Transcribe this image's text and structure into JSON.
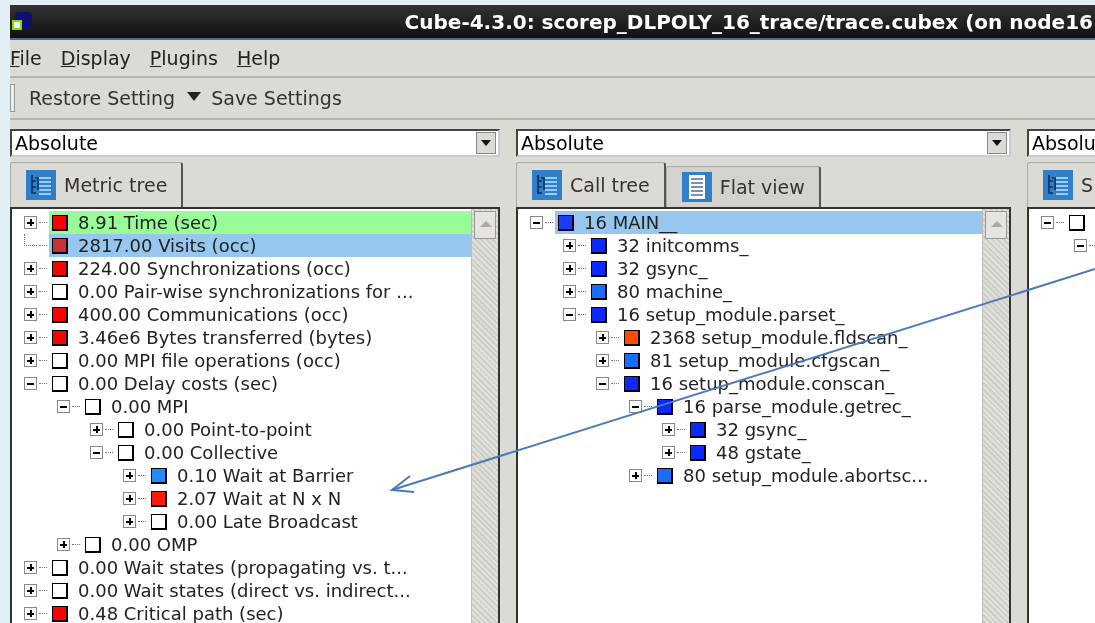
{
  "window": {
    "title": "Cube-4.3.0: scorep_DLPOLY_16_trace/trace.cubex (on node16"
  },
  "menu": [
    "File",
    "Display",
    "Plugins",
    "Help"
  ],
  "toolbar": {
    "restore": "Restore Setting",
    "save": "Save Settings"
  },
  "panes": [
    {
      "mode": "Absolute",
      "cut_off": false,
      "tabs": [
        {
          "label": "Metric tree",
          "kind": "tree",
          "selected": true
        }
      ],
      "tree": [
        {
          "label": "8.91 Time (sec)",
          "color": "#ff0000",
          "expanded": false,
          "selected": false,
          "marked": true
        },
        {
          "label": "2817.00 Visits (occ)",
          "color": "#c8303c",
          "expanded": false,
          "leaf": true,
          "selected": true,
          "marked": false
        },
        {
          "label": "224.00 Synchronizations (occ)",
          "color": "#ff0000",
          "expanded": false,
          "selected": false,
          "marked": false
        },
        {
          "label": "0.00 Pair-wise synchronizations for ...",
          "color": "#ffffff",
          "expanded": false,
          "selected": false,
          "marked": false
        },
        {
          "label": "400.00 Communications (occ)",
          "color": "#ff0000",
          "expanded": false,
          "selected": false,
          "marked": false
        },
        {
          "label": "3.46e6 Bytes transferred (bytes)",
          "color": "#ff0000",
          "expanded": false,
          "selected": false,
          "marked": false
        },
        {
          "label": "0.00 MPI file operations (occ)",
          "color": "#ffffff",
          "expanded": false,
          "selected": false,
          "marked": false
        },
        {
          "label": "0.00 Delay costs (sec)",
          "color": "#ffffff",
          "expanded": true,
          "selected": false,
          "marked": false,
          "children": [
            {
              "label": "0.00 MPI",
              "color": "#ffffff",
              "expanded": true,
              "selected": false,
              "marked": false,
              "children": [
                {
                  "label": "0.00 Point-to-point",
                  "color": "#ffffff",
                  "expanded": false,
                  "selected": false,
                  "marked": false
                },
                {
                  "label": "0.00 Collective",
                  "color": "#ffffff",
                  "expanded": true,
                  "selected": false,
                  "marked": false,
                  "children": [
                    {
                      "label": "0.10 Wait at Barrier",
                      "color": "#1e8cff",
                      "expanded": false,
                      "selected": false,
                      "marked": false
                    },
                    {
                      "label": "2.07 Wait at N x N",
                      "color": "#ff1a0a",
                      "expanded": false,
                      "selected": false,
                      "marked": false
                    },
                    {
                      "label": "0.00 Late Broadcast",
                      "color": "#ffffff",
                      "expanded": false,
                      "selected": false,
                      "marked": false
                    }
                  ]
                }
              ]
            },
            {
              "label": "0.00 OMP",
              "color": "#ffffff",
              "expanded": false,
              "selected": false,
              "marked": false
            }
          ]
        },
        {
          "label": "0.00 Wait states (propagating vs. t...",
          "color": "#ffffff",
          "expanded": false,
          "selected": false,
          "marked": false
        },
        {
          "label": "0.00 Wait states (direct vs. indirect...",
          "color": "#ffffff",
          "expanded": false,
          "selected": false,
          "marked": false
        },
        {
          "label": "0.48 Critical path (sec)",
          "color": "#ff0000",
          "expanded": false,
          "selected": false,
          "marked": false
        }
      ]
    },
    {
      "mode": "Absolute",
      "cut_off": false,
      "tabs": [
        {
          "label": "Call tree",
          "kind": "tree",
          "selected": true
        },
        {
          "label": "Flat view",
          "kind": "list",
          "selected": false
        }
      ],
      "tree": [
        {
          "label": "16 MAIN__",
          "color": "#1a3cff",
          "expanded": true,
          "selected": true,
          "marked": false,
          "children": [
            {
              "label": "32 initcomms_",
              "color": "#0a2aff",
              "expanded": false,
              "selected": false,
              "marked": false
            },
            {
              "label": "32 gsync_",
              "color": "#0a2aff",
              "expanded": false,
              "selected": false,
              "marked": false
            },
            {
              "label": "80 machine_",
              "color": "#1a6cff",
              "expanded": false,
              "selected": false,
              "marked": false
            },
            {
              "label": "16 setup_module.parset_",
              "color": "#0a2aff",
              "expanded": true,
              "selected": false,
              "marked": false,
              "children": [
                {
                  "label": "2368 setup_module.fldscan_",
                  "color": "#ff4a00",
                  "expanded": false,
                  "selected": false,
                  "marked": false
                },
                {
                  "label": "81 setup_module.cfgscan_",
                  "color": "#1a6cff",
                  "expanded": false,
                  "selected": false,
                  "marked": false
                },
                {
                  "label": "16 setup_module.conscan_",
                  "color": "#0a2aff",
                  "expanded": true,
                  "selected": false,
                  "marked": false,
                  "children": [
                    {
                      "label": "16 parse_module.getrec_",
                      "color": "#0a2aff",
                      "expanded": true,
                      "selected": false,
                      "marked": false,
                      "children": [
                        {
                          "label": "32 gsync_",
                          "color": "#0a2aff",
                          "expanded": false,
                          "selected": false,
                          "marked": false
                        },
                        {
                          "label": "48 gstate_",
                          "color": "#0a2aff",
                          "expanded": false,
                          "selected": false,
                          "marked": false
                        }
                      ]
                    },
                    {
                      "label": "80 setup_module.abortsc...",
                      "color": "#1a6cff",
                      "expanded": false,
                      "selected": false,
                      "marked": false
                    }
                  ]
                }
              ]
            }
          ]
        }
      ]
    },
    {
      "mode": "Absolu",
      "cut_off": true,
      "tabs": [
        {
          "label": "S",
          "kind": "tree",
          "selected": true
        }
      ],
      "tree": [
        {
          "color": "#ffffff",
          "expanded": true,
          "selected": false,
          "marked": false,
          "children": [
            {
              "expanded": true
            }
          ]
        }
      ]
    }
  ]
}
